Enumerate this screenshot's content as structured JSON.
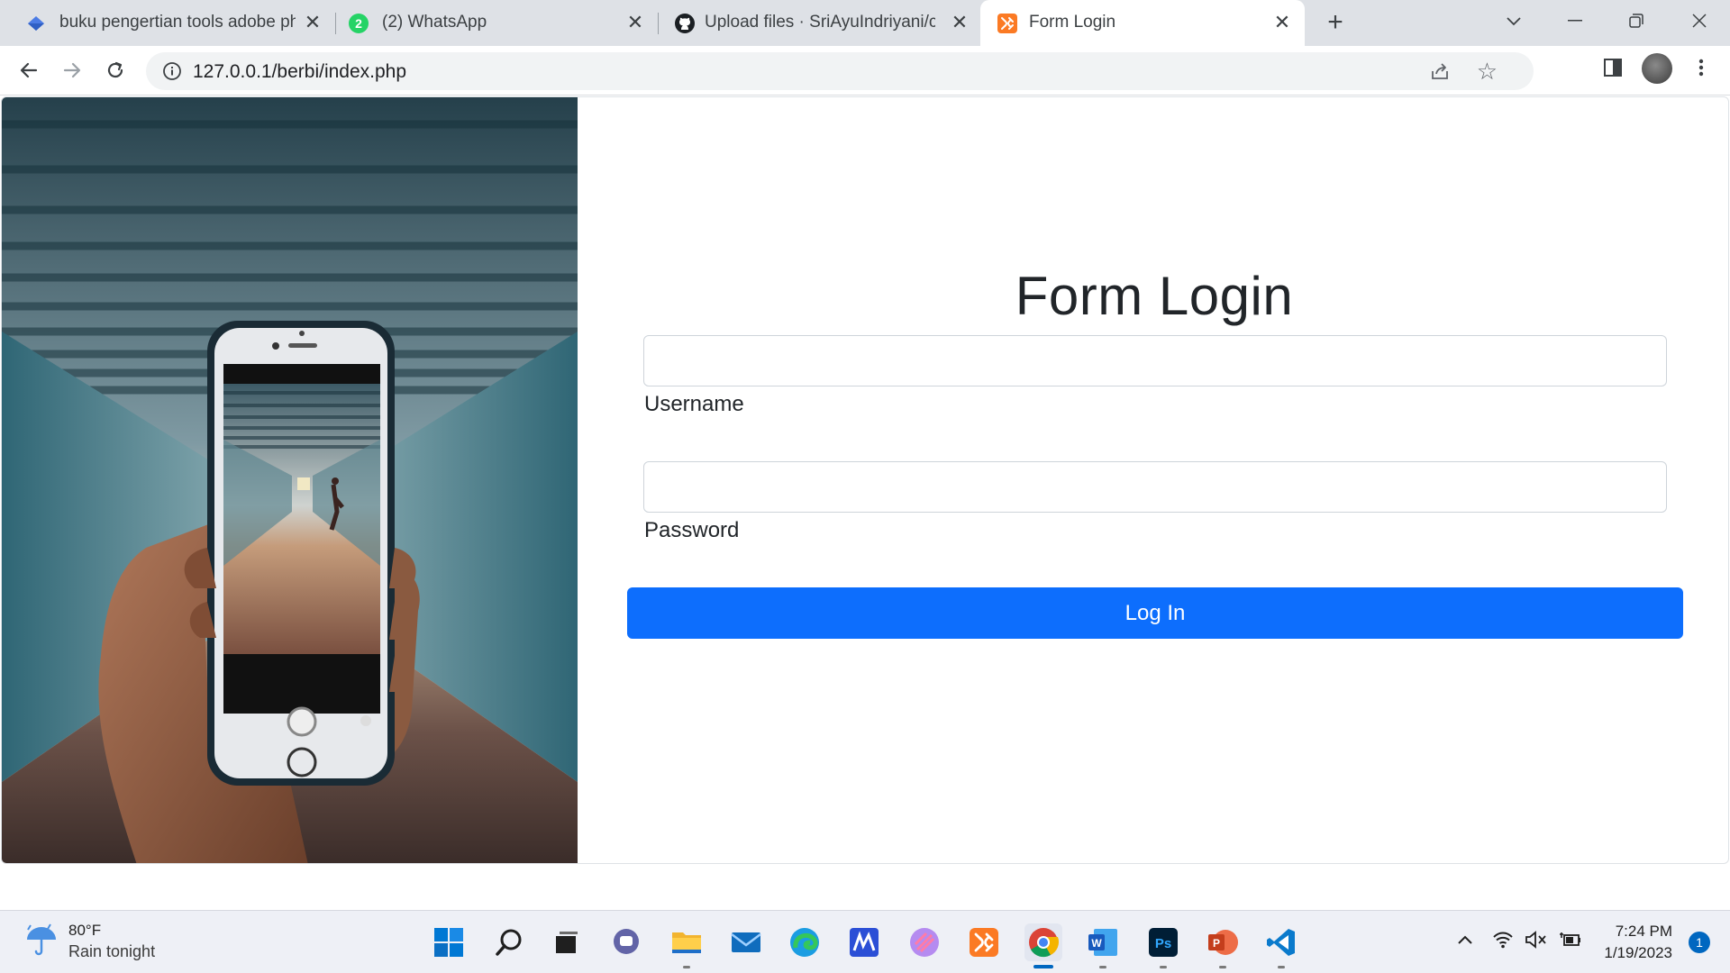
{
  "browser": {
    "tabs": [
      {
        "title": "buku pengertian tools adobe ph",
        "favicon": "diamond-favicon",
        "active": false
      },
      {
        "title": "(2) WhatsApp",
        "favicon": "whatsapp-favicon",
        "badge": "2",
        "active": false
      },
      {
        "title": "Upload files · SriAyuIndriyani/cre",
        "favicon": "github-favicon",
        "active": false
      },
      {
        "title": "Form Login",
        "favicon": "xampp-favicon",
        "active": true
      }
    ],
    "url": "127.0.0.1/berbi/index.php"
  },
  "page": {
    "title": "Form Login",
    "username_label": "Username",
    "username_value": "",
    "password_label": "Password",
    "password_value": "",
    "login_button": "Log In"
  },
  "taskbar": {
    "weather_temp": "80°F",
    "weather_condition": "Rain tonight",
    "time": "7:24 PM",
    "date": "1/19/2023",
    "notification_count": "1",
    "apps": [
      "start",
      "search",
      "task-view",
      "teams-chat",
      "file-explorer",
      "mail",
      "edge",
      "app-ma",
      "app-swirl",
      "xampp",
      "chrome",
      "word",
      "photoshop",
      "powerpoint",
      "vscode"
    ]
  },
  "colors": {
    "primary": "#0d6efd",
    "tabstrip": "#dee1e6",
    "taskbar": "#eef0f6"
  }
}
